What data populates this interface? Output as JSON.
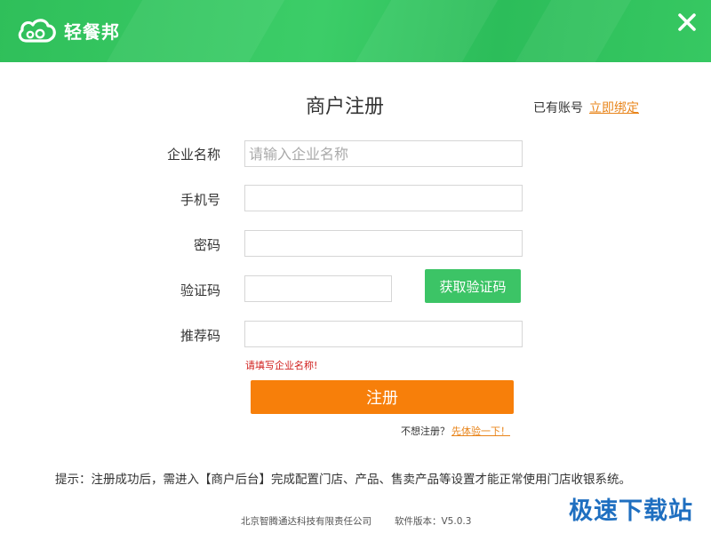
{
  "app": {
    "logo_text": "轻餐邦"
  },
  "header": {
    "close_icon": "close-icon"
  },
  "form": {
    "title": "商户注册",
    "has_account": "已有账号",
    "bind_link": "立即绑定",
    "fields": {
      "company": {
        "label": "企业名称",
        "placeholder": "请输入企业名称",
        "value": ""
      },
      "phone": {
        "label": "手机号",
        "placeholder": "",
        "value": ""
      },
      "password": {
        "label": "密码",
        "placeholder": "",
        "value": ""
      },
      "code": {
        "label": "验证码",
        "placeholder": "",
        "value": ""
      },
      "referral": {
        "label": "推荐码",
        "placeholder": "",
        "value": ""
      }
    },
    "get_code_label": "获取验证码",
    "error_message": "请填写企业名称!",
    "register_label": "注册",
    "try_text": "不想注册？",
    "try_link": "先体验一下！"
  },
  "tip": "提示：注册成功后，需进入【商户后台】完成配置门店、产品、售卖产品等设置才能正常使用门店收银系统。",
  "footer": {
    "company": "北京智腾通达科技有限责任公司",
    "version": "软件版本：V5.0.3"
  },
  "watermark": "极速下载站",
  "colors": {
    "header_green": "#3cc466",
    "accent_orange": "#f77f0a",
    "link_orange": "#e8841a",
    "error_red": "#d0201e"
  }
}
